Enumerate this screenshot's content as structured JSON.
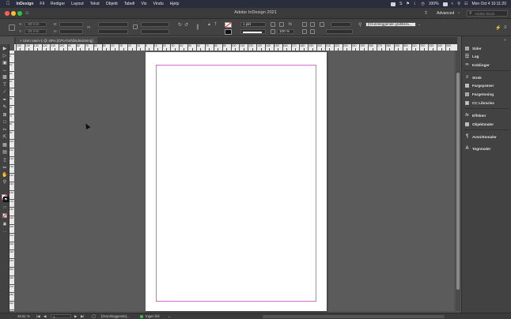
{
  "menubar": {
    "apple_icon": "apple-icon",
    "items": [
      "InDesign",
      "Fil",
      "Rediger",
      "Layout",
      "Tekst",
      "Objekt",
      "Tabell",
      "Vis",
      "Vindu",
      "Hjelp"
    ],
    "battery": "100%",
    "clock": "Mon Oct 4  10:11:20"
  },
  "window": {
    "title": "Adobe InDesign 2021",
    "workspace": "Advanced",
    "search_placeholder": "Adobe Stock"
  },
  "controlbar": {
    "x_field": "-89 mm",
    "y_field": "-25 mm",
    "stroke_weight": "1 pkt",
    "zoom_value": "100 %",
    "object_style": "[Grunnleggende grafikkra..."
  },
  "document_tab": {
    "label": "Uten navn-1 @ 49% [CPU-forhåndsvisning]",
    "close_icon": "close-icon"
  },
  "rulers": {
    "h_labels": [
      "150",
      "140",
      "130",
      "120",
      "110",
      "100",
      "90",
      "80",
      "70",
      "60",
      "50",
      "40",
      "30",
      "20",
      "10",
      "0",
      "10",
      "20",
      "30",
      "40",
      "50",
      "60",
      "70",
      "80",
      "90",
      "100",
      "110",
      "120",
      "130",
      "140",
      "150",
      "160",
      "170",
      "180",
      "190",
      "200",
      "210",
      "220",
      "230",
      "240",
      "250",
      "260",
      "270",
      "280",
      "290",
      "300",
      "310",
      "320",
      "330",
      "340",
      "350"
    ],
    "v_labels": [
      "0",
      "10",
      "20",
      "30",
      "40",
      "50",
      "60",
      "70",
      "80",
      "90",
      "100",
      "110",
      "120",
      "130",
      "140",
      "150",
      "160",
      "170",
      "180",
      "190",
      "200",
      "210",
      "220",
      "230",
      "240",
      "250",
      "260",
      "270",
      "280",
      "290",
      "300"
    ]
  },
  "panels": [
    {
      "label": "Sider",
      "icon": "pages-icon"
    },
    {
      "label": "Lag",
      "icon": "layers-icon"
    },
    {
      "label": "Koblinger",
      "icon": "links-icon"
    },
    {
      "label": "Strek",
      "icon": "stroke-icon"
    },
    {
      "label": "Fargeprøver",
      "icon": "swatches-icon"
    },
    {
      "label": "Fargetoning",
      "icon": "gradient-icon"
    },
    {
      "label": "CC Libraries",
      "icon": "cc-libraries-icon"
    },
    {
      "label": "Effekter",
      "icon": "effects-icon"
    },
    {
      "label": "Objektmaler",
      "icon": "object-styles-icon"
    },
    {
      "label": "Avsnittsmaler",
      "icon": "paragraph-styles-icon"
    },
    {
      "label": "Tegnmaler",
      "icon": "character-styles-icon"
    }
  ],
  "statusbar": {
    "zoom": "48.61 %",
    "page_number": "1",
    "preflight_profile": "[Grunnleggende]...",
    "errors": "Ingen feil"
  }
}
